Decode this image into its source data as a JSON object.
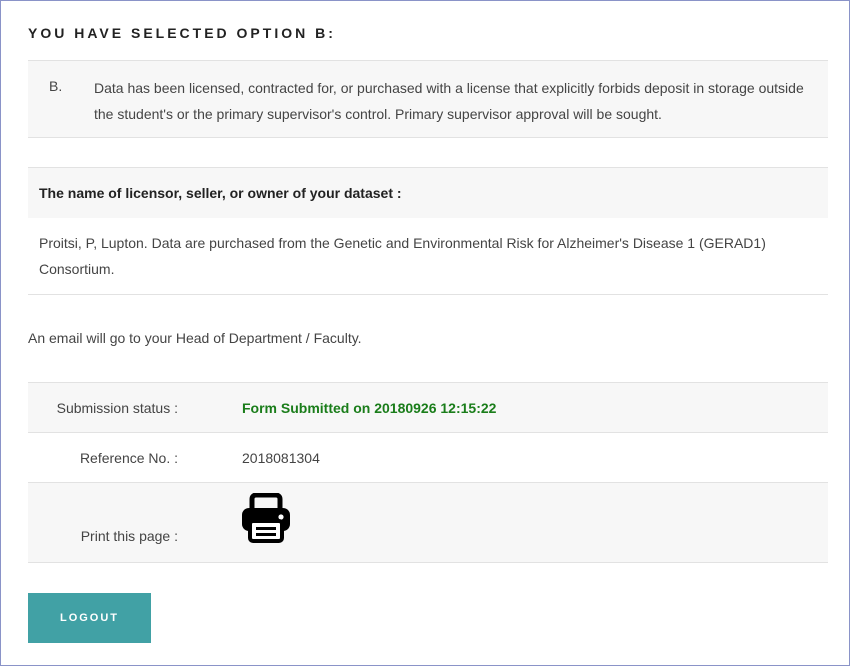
{
  "heading": "YOU HAVE SELECTED OPTION B:",
  "option": {
    "letter": "B.",
    "text": "Data has been licensed, contracted for, or purchased with a license that explicitly forbids deposit in storage outside the student's or the primary supervisor's control. Primary supervisor approval will be sought."
  },
  "licensor": {
    "label": "The name of licensor, seller, or owner of your dataset :",
    "value": "Proitsi, P, Lupton. Data are purchased from the Genetic and Environmental Risk for Alzheimer's Disease 1 (GERAD1) Consortium."
  },
  "email_note": "An email will go to your Head of Department / Faculty.",
  "status": {
    "submission_label": "Submission status :",
    "submission_value": "Form Submitted on 20180926 12:15:22",
    "reference_label": "Reference No. :",
    "reference_value": "2018081304",
    "print_label": "Print this page :",
    "print_icon": "printer-icon"
  },
  "logout_label": "LOGOUT",
  "colors": {
    "accent": "#41a1a5",
    "success": "#1a7d1a",
    "frame_border": "#8a93c8",
    "row_grey": "#f7f7f7"
  }
}
